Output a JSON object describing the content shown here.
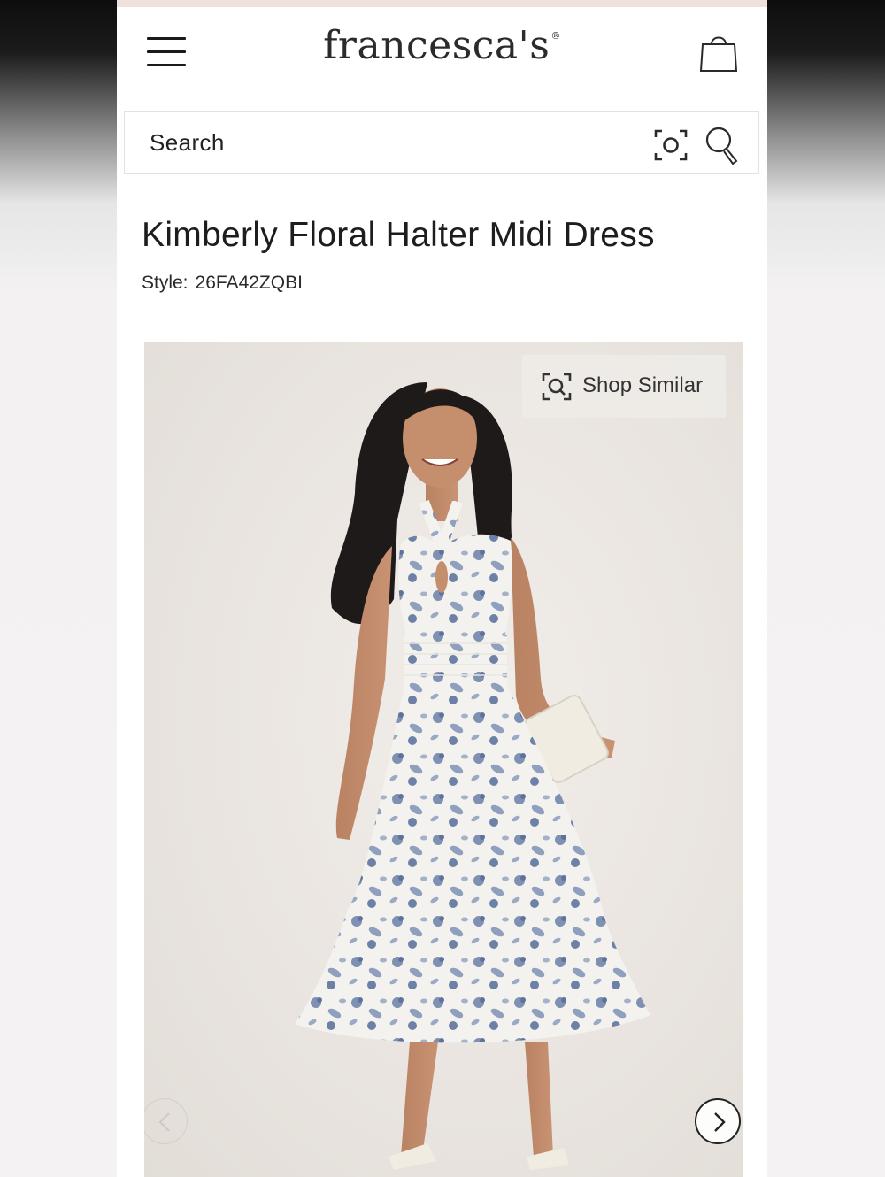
{
  "header": {
    "menu_icon": "hamburger-menu-icon",
    "logo_text": "francesca's",
    "cart_icon": "shopping-bag-icon"
  },
  "search": {
    "placeholder": "Search",
    "visual_search_icon": "camera-scan-icon",
    "search_icon": "magnifier-icon"
  },
  "product": {
    "title": "Kimberly Floral Halter Midi Dress",
    "style_label": "Style:",
    "style_code": "26FA42ZQBI"
  },
  "gallery": {
    "shop_similar_label": "Shop Similar",
    "shop_similar_icon": "scan-search-icon",
    "prev_icon": "chevron-left-icon",
    "next_icon": "chevron-right-icon"
  },
  "colors": {
    "top_strip": "#efe2dc",
    "dress_print": "#6a7ea3",
    "text_primary": "#1d1d1d"
  }
}
